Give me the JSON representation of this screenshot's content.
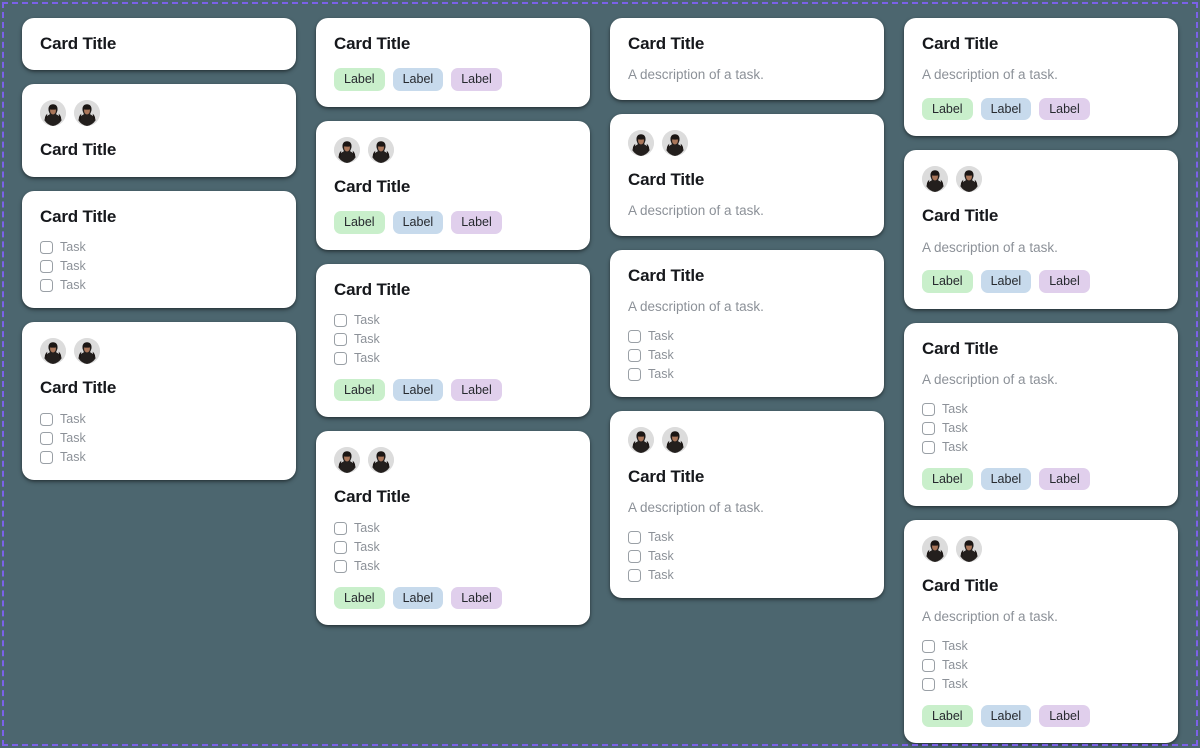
{
  "theme": {
    "background": "#4c666f",
    "frame_border": "#7b61e8",
    "card_background": "#ffffff",
    "title_color": "#16181c",
    "muted_text": "#8c9198",
    "chip_green": "#c9efcb",
    "chip_blue": "#c7daec",
    "chip_purple": "#e0cfec"
  },
  "text": {
    "card_title": "Card Title",
    "description": "A description of a task.",
    "task": "Task",
    "label": "Label"
  },
  "columns": [
    {
      "name": "column-1",
      "cards": [
        {
          "avatars": 0,
          "title": "Card Title",
          "description": null,
          "tasks": [],
          "labels": []
        },
        {
          "avatars": 2,
          "title": "Card Title",
          "description": null,
          "tasks": [],
          "labels": []
        },
        {
          "avatars": 0,
          "title": "Card Title",
          "description": null,
          "tasks": [
            "Task",
            "Task",
            "Task"
          ],
          "labels": []
        },
        {
          "avatars": 2,
          "title": "Card Title",
          "description": null,
          "tasks": [
            "Task",
            "Task",
            "Task"
          ],
          "labels": []
        }
      ]
    },
    {
      "name": "column-2",
      "cards": [
        {
          "avatars": 0,
          "title": "Card Title",
          "description": null,
          "tasks": [],
          "labels": [
            "Label",
            "Label",
            "Label"
          ]
        },
        {
          "avatars": 2,
          "title": "Card Title",
          "description": null,
          "tasks": [],
          "labels": [
            "Label",
            "Label",
            "Label"
          ]
        },
        {
          "avatars": 0,
          "title": "Card Title",
          "description": null,
          "tasks": [
            "Task",
            "Task",
            "Task"
          ],
          "labels": [
            "Label",
            "Label",
            "Label"
          ]
        },
        {
          "avatars": 2,
          "title": "Card Title",
          "description": null,
          "tasks": [
            "Task",
            "Task",
            "Task"
          ],
          "labels": [
            "Label",
            "Label",
            "Label"
          ]
        }
      ]
    },
    {
      "name": "column-3",
      "cards": [
        {
          "avatars": 0,
          "title": "Card Title",
          "description": "A description of a task.",
          "tasks": [],
          "labels": []
        },
        {
          "avatars": 2,
          "title": "Card Title",
          "description": "A description of a task.",
          "tasks": [],
          "labels": []
        },
        {
          "avatars": 0,
          "title": "Card Title",
          "description": "A description of a task.",
          "tasks": [
            "Task",
            "Task",
            "Task"
          ],
          "labels": []
        },
        {
          "avatars": 2,
          "title": "Card Title",
          "description": "A description of a task.",
          "tasks": [
            "Task",
            "Task",
            "Task"
          ],
          "labels": []
        }
      ]
    },
    {
      "name": "column-4",
      "cards": [
        {
          "avatars": 0,
          "title": "Card Title",
          "description": "A description of a task.",
          "tasks": [],
          "labels": [
            "Label",
            "Label",
            "Label"
          ]
        },
        {
          "avatars": 2,
          "title": "Card Title",
          "description": "A description of a task.",
          "tasks": [],
          "labels": [
            "Label",
            "Label",
            "Label"
          ]
        },
        {
          "avatars": 0,
          "title": "Card Title",
          "description": "A description of a task.",
          "tasks": [
            "Task",
            "Task",
            "Task"
          ],
          "labels": [
            "Label",
            "Label",
            "Label"
          ]
        },
        {
          "avatars": 2,
          "title": "Card Title",
          "description": "A description of a task.",
          "tasks": [
            "Task",
            "Task",
            "Task"
          ],
          "labels": [
            "Label",
            "Label",
            "Label"
          ]
        }
      ]
    }
  ]
}
